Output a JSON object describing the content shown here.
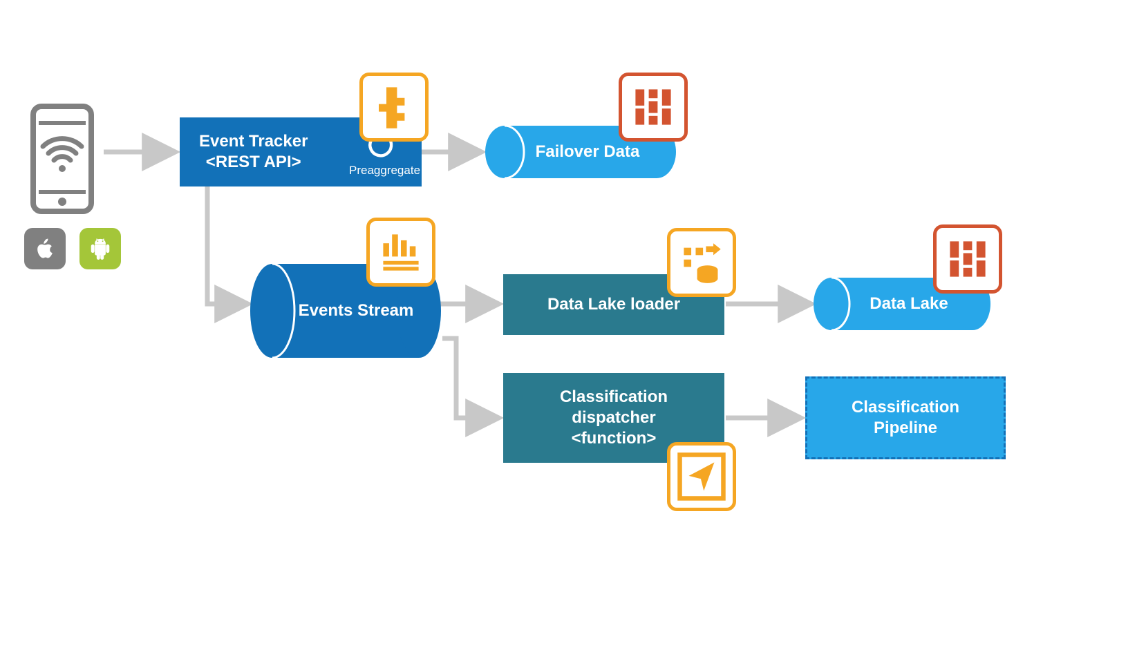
{
  "colors": {
    "blue_primary": "#1271B8",
    "blue_light": "#28A7E9",
    "teal": "#2A7A8E",
    "gray": "#808080",
    "gray_light": "#C8C8C8",
    "orange": "#F5A623",
    "orange_dark": "#D35430",
    "green": "#A4C639",
    "white": "#FFFFFF"
  },
  "nodes": {
    "event_tracker": {
      "label": "Event Tracker\n<REST API>",
      "sublabel": "Preaggregate"
    },
    "failover_data": {
      "label": "Failover Data"
    },
    "events_stream": {
      "label": "Events Stream"
    },
    "data_lake_loader": {
      "label": "Data Lake loader"
    },
    "data_lake": {
      "label": "Data Lake"
    },
    "classification_dispatcher": {
      "label": "Classification\ndispatcher\n<function>"
    },
    "classification_pipeline": {
      "label": "Classification\nPipeline"
    }
  },
  "icons": {
    "phone": "phone-wifi-icon",
    "apple": "apple-icon",
    "android": "android-icon",
    "tracker_badge": "pipeline-shape-icon",
    "failover_badge": "columns-icon",
    "stream_badge": "bar-chart-icon",
    "loader_badge": "migrate-icon",
    "datalake_badge": "columns-icon",
    "dispatcher_badge": "send-triangle-icon",
    "refresh": "refresh-icon"
  }
}
